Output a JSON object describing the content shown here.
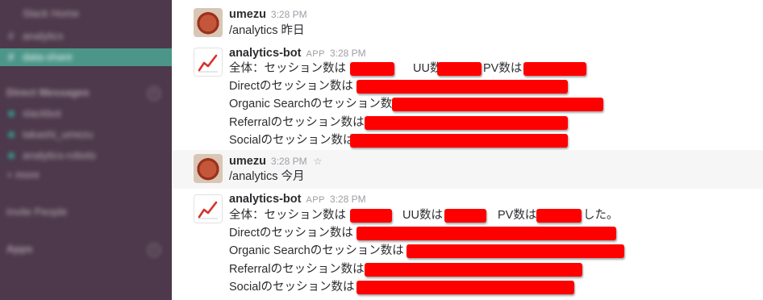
{
  "sidebar": {
    "rows": [
      {
        "label": "Slack Home",
        "kind": "plain",
        "blur": true
      },
      {
        "label": "analytics",
        "kind": "channel",
        "blur": true
      },
      {
        "label": "data-share",
        "kind": "channel-active",
        "blur": true
      },
      {
        "label": "Direct Messages",
        "kind": "header",
        "blur": true
      },
      {
        "label": "slackbot",
        "kind": "dm",
        "blur": true
      },
      {
        "label": "takashi_umezu",
        "kind": "dm",
        "blur": true
      },
      {
        "label": "analytics-robots",
        "kind": "dm",
        "blur": true
      },
      {
        "label": "+ more",
        "kind": "plain",
        "blur": true
      },
      {
        "label": "Invite People",
        "kind": "plain",
        "blur": true
      },
      {
        "label": "Apps",
        "kind": "header",
        "blur": true
      }
    ]
  },
  "messages": [
    {
      "sender": "umezu",
      "app": "",
      "time": "3:28 PM",
      "avatar": "user",
      "star": "",
      "lines": [
        "/analytics 昨日"
      ]
    },
    {
      "sender": "analytics-bot",
      "app": "APP",
      "time": "3:28 PM",
      "avatar": "bot",
      "star": "",
      "lines": [
        "全体：セッション数は",
        "Directのセッション数は",
        "Organic Searchのセッション数",
        "Referralのセッション数は",
        "Socialのセッション数は"
      ],
      "inline": {
        "uu": "UU数は",
        "pv": "PV数は"
      }
    },
    {
      "sender": "umezu",
      "app": "",
      "time": "3:28 PM",
      "avatar": "user",
      "star": "☆",
      "lines": [
        "/analytics 今月"
      ]
    },
    {
      "sender": "analytics-bot",
      "app": "APP",
      "time": "3:28 PM",
      "avatar": "bot",
      "star": "",
      "lines": [
        "全体：セッション数は",
        "Directのセッション数は",
        "Organic Searchのセッション数は",
        "Referralのセッション数は",
        "Socialのセッション数は"
      ],
      "inline": {
        "uu": "UU数は",
        "pv": "PV数は",
        "tail": "した。"
      }
    }
  ]
}
